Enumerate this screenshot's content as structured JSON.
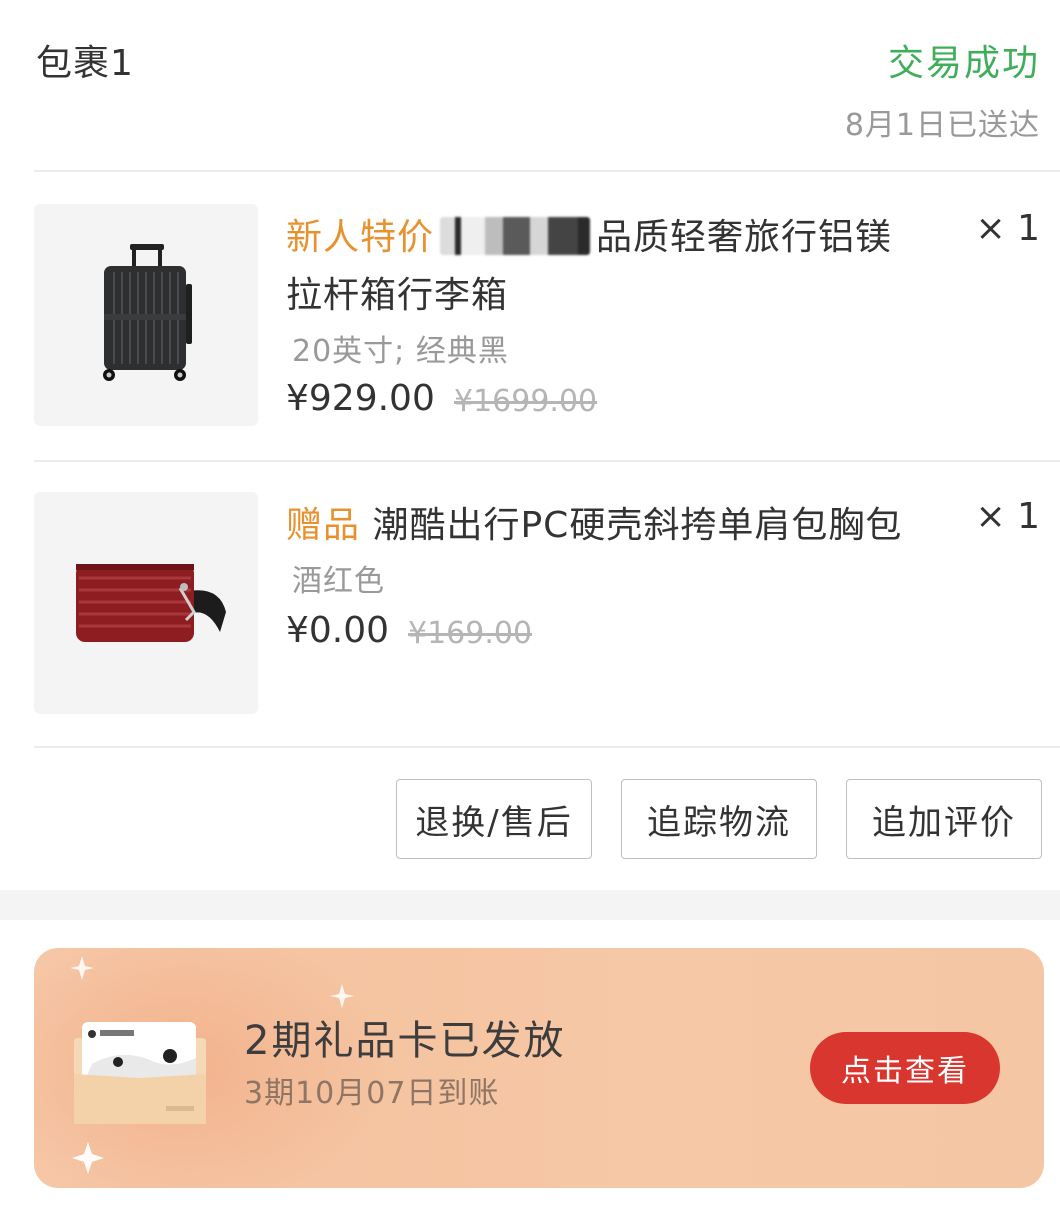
{
  "package": {
    "title": "包裹1",
    "status": "交易成功",
    "delivered": "8月1日已送达",
    "status_color": "#3fae5a"
  },
  "items": [
    {
      "tag": "新人特价",
      "title_after_blur": "品质轻奢旅行铝镁",
      "title_line2": "拉杆箱行李箱",
      "qty": "× 1",
      "spec": "20英寸; 经典黑",
      "price": "¥929.00",
      "orig_price": "¥1699.00",
      "image": "suitcase-black"
    },
    {
      "tag": "赠品",
      "title": "潮酷出行PC硬壳斜挎单肩包胸包",
      "qty": "× 1",
      "spec": "酒红色",
      "price": "¥0.00",
      "orig_price": "¥169.00",
      "image": "crossbody-bag-red"
    }
  ],
  "actions": {
    "return": "退换/售后",
    "track": "追踪物流",
    "review": "追加评价"
  },
  "banner": {
    "title": "2期礼品卡已发放",
    "subtitle": "3期10月07日到账",
    "button": "点击查看",
    "button_color": "#d9362f",
    "icon": "gift-card-envelope"
  }
}
